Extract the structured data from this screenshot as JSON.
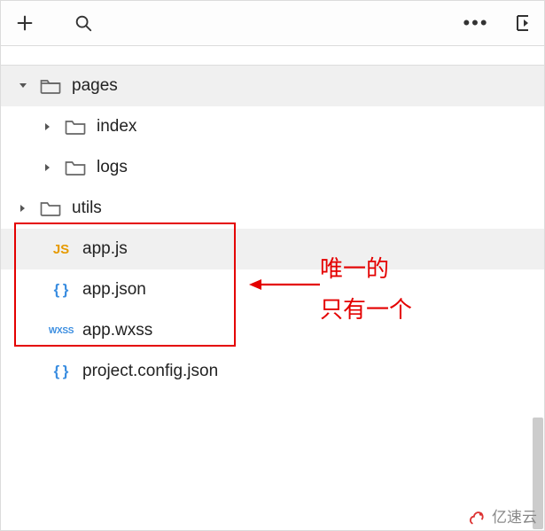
{
  "toolbar": {
    "add_icon": "add",
    "search_icon": "search",
    "more_icon": "more",
    "collapse_icon": "collapse"
  },
  "tree": {
    "items": [
      {
        "label": "pages",
        "type": "folder-open",
        "expanded": true,
        "indent": 1,
        "shade": true
      },
      {
        "label": "index",
        "type": "folder",
        "expanded": false,
        "indent": 2,
        "shade": false
      },
      {
        "label": "logs",
        "type": "folder",
        "expanded": false,
        "indent": 2,
        "shade": false
      },
      {
        "label": "utils",
        "type": "folder",
        "expanded": false,
        "indent": 1,
        "shade": false
      },
      {
        "label": "app.js",
        "type": "js",
        "indent": 3,
        "shade": true
      },
      {
        "label": "app.json",
        "type": "json",
        "indent": 3,
        "shade": false
      },
      {
        "label": "app.wxss",
        "type": "wxss",
        "indent": 3,
        "shade": false
      },
      {
        "label": "project.config.json",
        "type": "json",
        "indent": 3,
        "shade": false
      }
    ]
  },
  "annotation": {
    "line1": "唯一的",
    "line2": "只有一个"
  },
  "watermark": "亿速云"
}
